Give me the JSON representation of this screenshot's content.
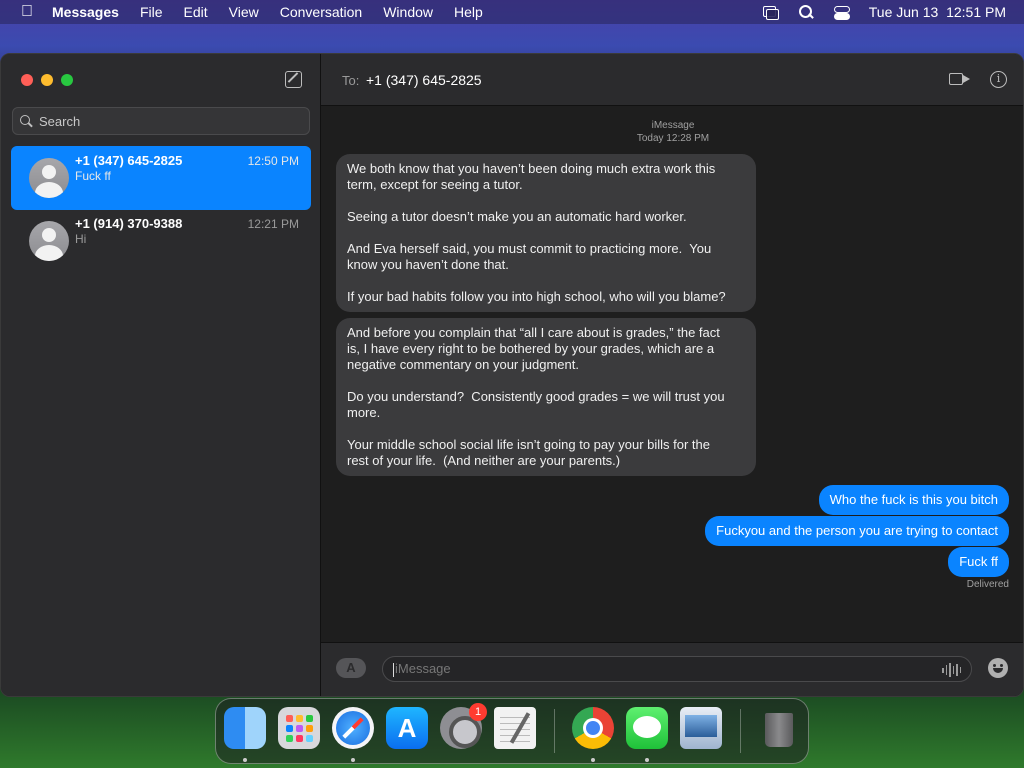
{
  "menubar": {
    "apple_icon": "apple-logo",
    "items": [
      "Messages",
      "File",
      "Edit",
      "View",
      "Conversation",
      "Window",
      "Help"
    ],
    "datetime": "Tue Jun 13  12:51 PM"
  },
  "sidebar": {
    "search_placeholder": "Search",
    "conversations": [
      {
        "name": "+1 (347) 645-2825",
        "time": "12:50 PM",
        "preview": "Fuck ff",
        "selected": true
      },
      {
        "name": "+1 (914) 370-9388",
        "time": "12:21 PM",
        "preview": "Hi",
        "selected": false
      }
    ]
  },
  "header": {
    "to_label": "To:",
    "to_value": "+1 (347) 645-2825"
  },
  "thread": {
    "service": "iMessage",
    "timestamp": "Today 12:28 PM",
    "incoming": [
      "We both know that you haven’t been doing much extra work this\nterm, except for seeing a tutor.\n\nSeeing a tutor doesn’t make you an automatic hard worker.\n\nAnd Eva herself said, you must commit to practicing more.  You\nknow you haven’t done that.\n\nIf your bad habits follow you into high school, who will you blame?",
      "And before you complain that “all I care about is grades,” the fact\nis, I have every right to be bothered by your grades, which are a\nnegative commentary on your judgment.\n\nDo you understand?  Consistently good grades = we will trust you\nmore.\n\nYour middle school social life isn’t going to pay your bills for the\nrest of your life.  (And neither are your parents.)"
    ],
    "outgoing": [
      "Who the fuck is this you bitch",
      "Fuckyou and the person you are trying to contact",
      "Fuck ff"
    ],
    "status": "Delivered"
  },
  "composer": {
    "placeholder": "iMessage",
    "apps_button": "A"
  },
  "dock": {
    "apps": [
      "Finder",
      "Launchpad",
      "Safari",
      "App Store",
      "System Settings",
      "TextEdit",
      "Google Chrome",
      "Messages",
      "Preview",
      "Trash"
    ],
    "settings_badge": "1"
  },
  "colors": {
    "accent": "#0a84ff",
    "incoming_bubble": "#3b3b3d",
    "sidebar": "#2b2b2d",
    "window_bg": "#1e1e1e"
  }
}
